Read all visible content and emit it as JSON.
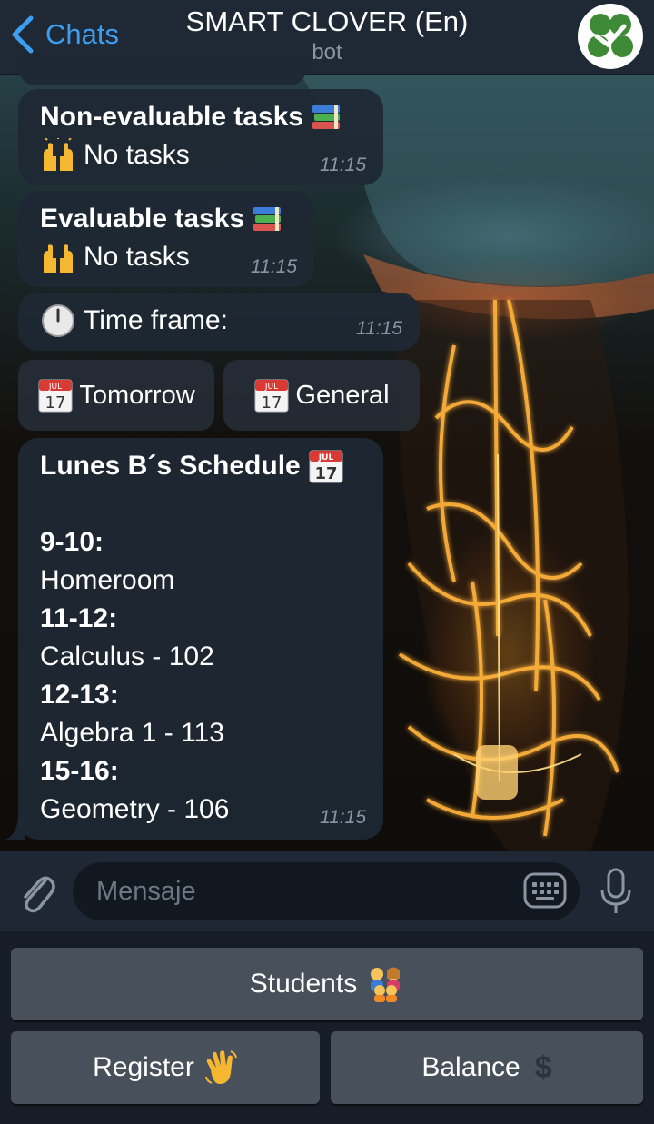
{
  "header": {
    "back_label": "Chats",
    "title": "SMART CLOVER (En)",
    "subtitle": "bot"
  },
  "messages": {
    "non_evaluable": {
      "title": "Non-evaluable tasks",
      "body": "No tasks",
      "time": "11:15"
    },
    "evaluable": {
      "title": "Evaluable tasks",
      "body": "No tasks",
      "time": "11:15"
    },
    "time_frame": {
      "text": "Time frame:",
      "time": "11:15"
    },
    "inline_buttons": [
      "Tomorrow",
      "General"
    ],
    "schedule": {
      "title": "Lunes B´s Schedule",
      "entries": [
        {
          "slot": "9-10:",
          "subject": "Homeroom"
        },
        {
          "slot": "11-12:",
          "subject": "Calculus - 102"
        },
        {
          "slot": "12-13:",
          "subject": "Algebra 1 - 113"
        },
        {
          "slot": "15-16:",
          "subject": "Geometry - 106"
        }
      ],
      "time": "11:15"
    }
  },
  "input": {
    "placeholder": "Mensaje"
  },
  "keyboard": {
    "students_label": "Students",
    "register_label": "Register",
    "balance_label": "Balance"
  },
  "icons": {
    "calendar_month": "JUL",
    "calendar_day": "17",
    "balance_symbol": "$"
  },
  "colors": {
    "accent": "#3c9ef0",
    "bubble": "#1e2834",
    "keyboard_button": "#48505b",
    "brand_green": "#3e8a36"
  }
}
